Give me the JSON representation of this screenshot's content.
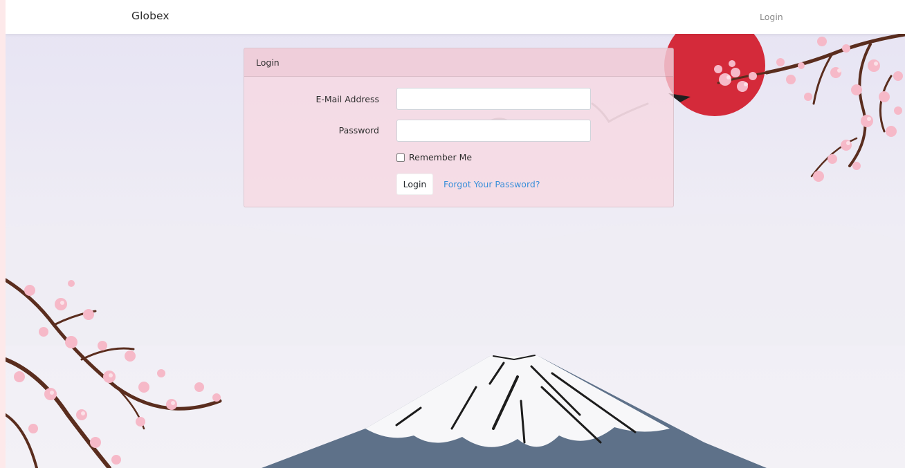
{
  "navbar": {
    "brand": "Globex",
    "login_link": "Login"
  },
  "login_card": {
    "header": "Login",
    "email": {
      "label": "E-Mail Address",
      "value": "",
      "placeholder": ""
    },
    "password": {
      "label": "Password",
      "value": "",
      "placeholder": ""
    },
    "remember": {
      "label": "Remember Me",
      "checked": false
    },
    "submit_label": "Login",
    "forgot_label": "Forgot Your Password?"
  },
  "colors": {
    "accent_link": "#3b8fd9",
    "card_tint": "#f8d7e0",
    "sun_red": "#d42a3a",
    "blossom_pink": "#f6b9c8",
    "branch_brown": "#5a2d1e",
    "mountain_slate": "#5e7189"
  },
  "background_icons": [
    "red-sun-icon",
    "cherry-blossom-icon",
    "mountain-fuji-icon",
    "bird-icon"
  ]
}
